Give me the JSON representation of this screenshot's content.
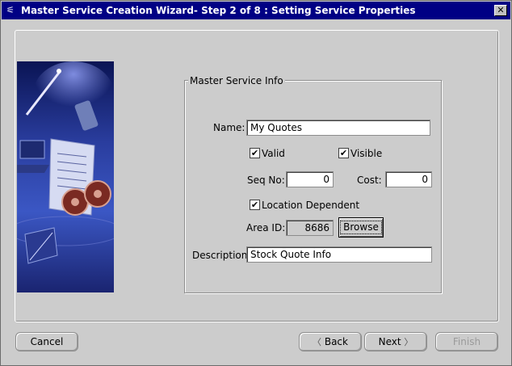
{
  "window": {
    "title": "Master Service Creation Wizard- Step 2 of 8 : Setting Service Properties",
    "close_label": "✕"
  },
  "group": {
    "legend": "Master Service Info"
  },
  "form": {
    "name_label": "Name:",
    "name_value": "My Quotes",
    "valid_label": "Valid",
    "valid_checked": true,
    "visible_label": "Visible",
    "visible_checked": true,
    "seq_label": "Seq No:",
    "seq_value": "0",
    "cost_label": "Cost:",
    "cost_value": "0",
    "location_label": "Location Dependent",
    "location_checked": true,
    "area_label": "Area ID:",
    "area_value": "8686",
    "browse_label": "Browse",
    "desc_label": "Description:",
    "desc_value": "Stock Quote Info",
    "check_mark": "✔"
  },
  "buttons": {
    "cancel": "Cancel",
    "back": "Back",
    "next": "Next",
    "finish": "Finish",
    "back_chevron": "〈",
    "next_chevron": "〉"
  },
  "colors": {
    "titlebar": "#000084",
    "dialog_bg": "#cccccc"
  }
}
